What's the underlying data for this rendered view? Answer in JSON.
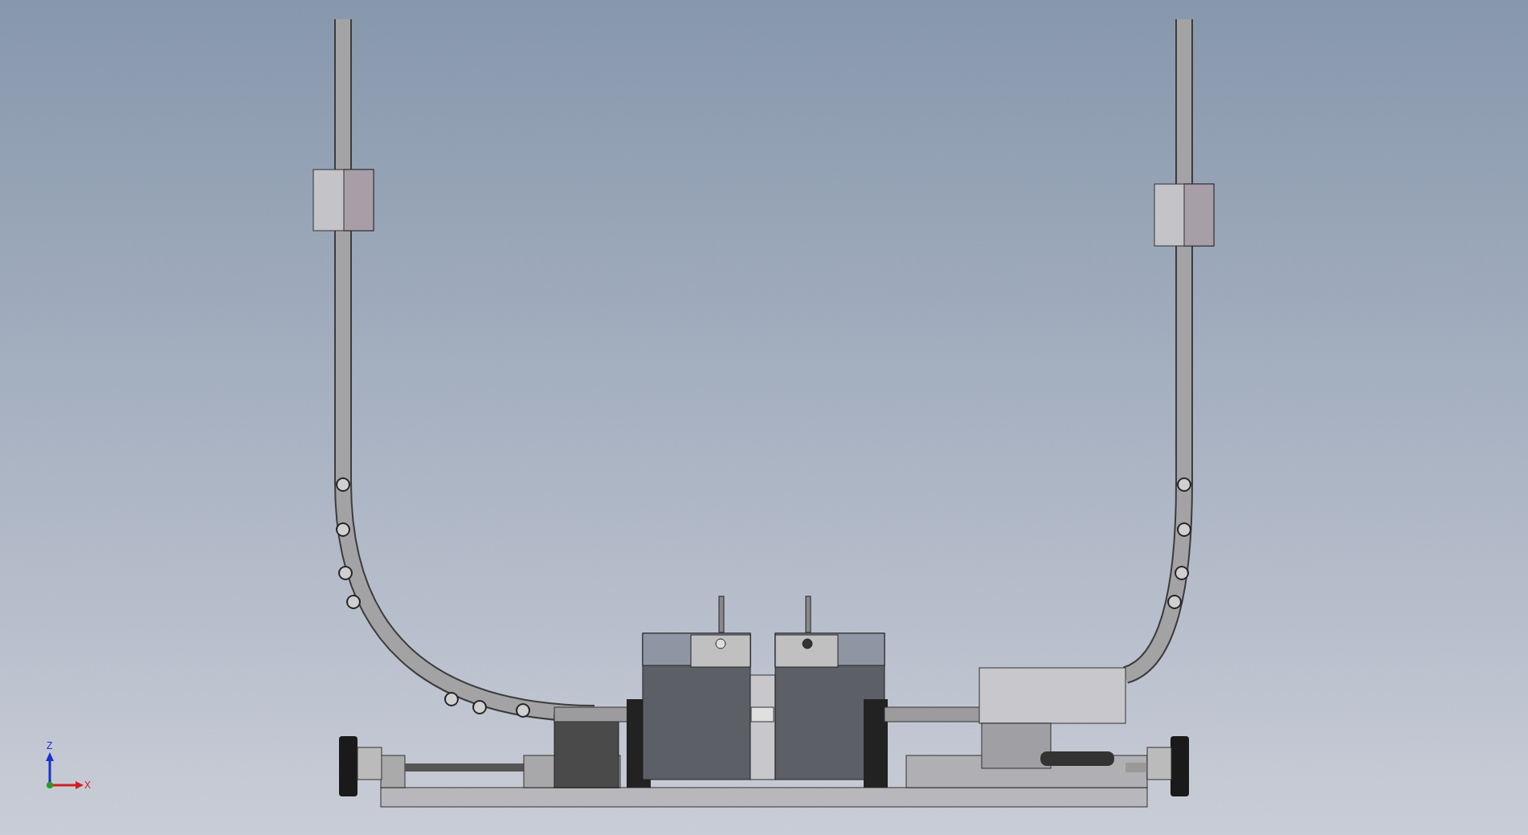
{
  "viewport": {
    "triad": {
      "axis_labels": [
        "Z",
        "X"
      ]
    }
  }
}
